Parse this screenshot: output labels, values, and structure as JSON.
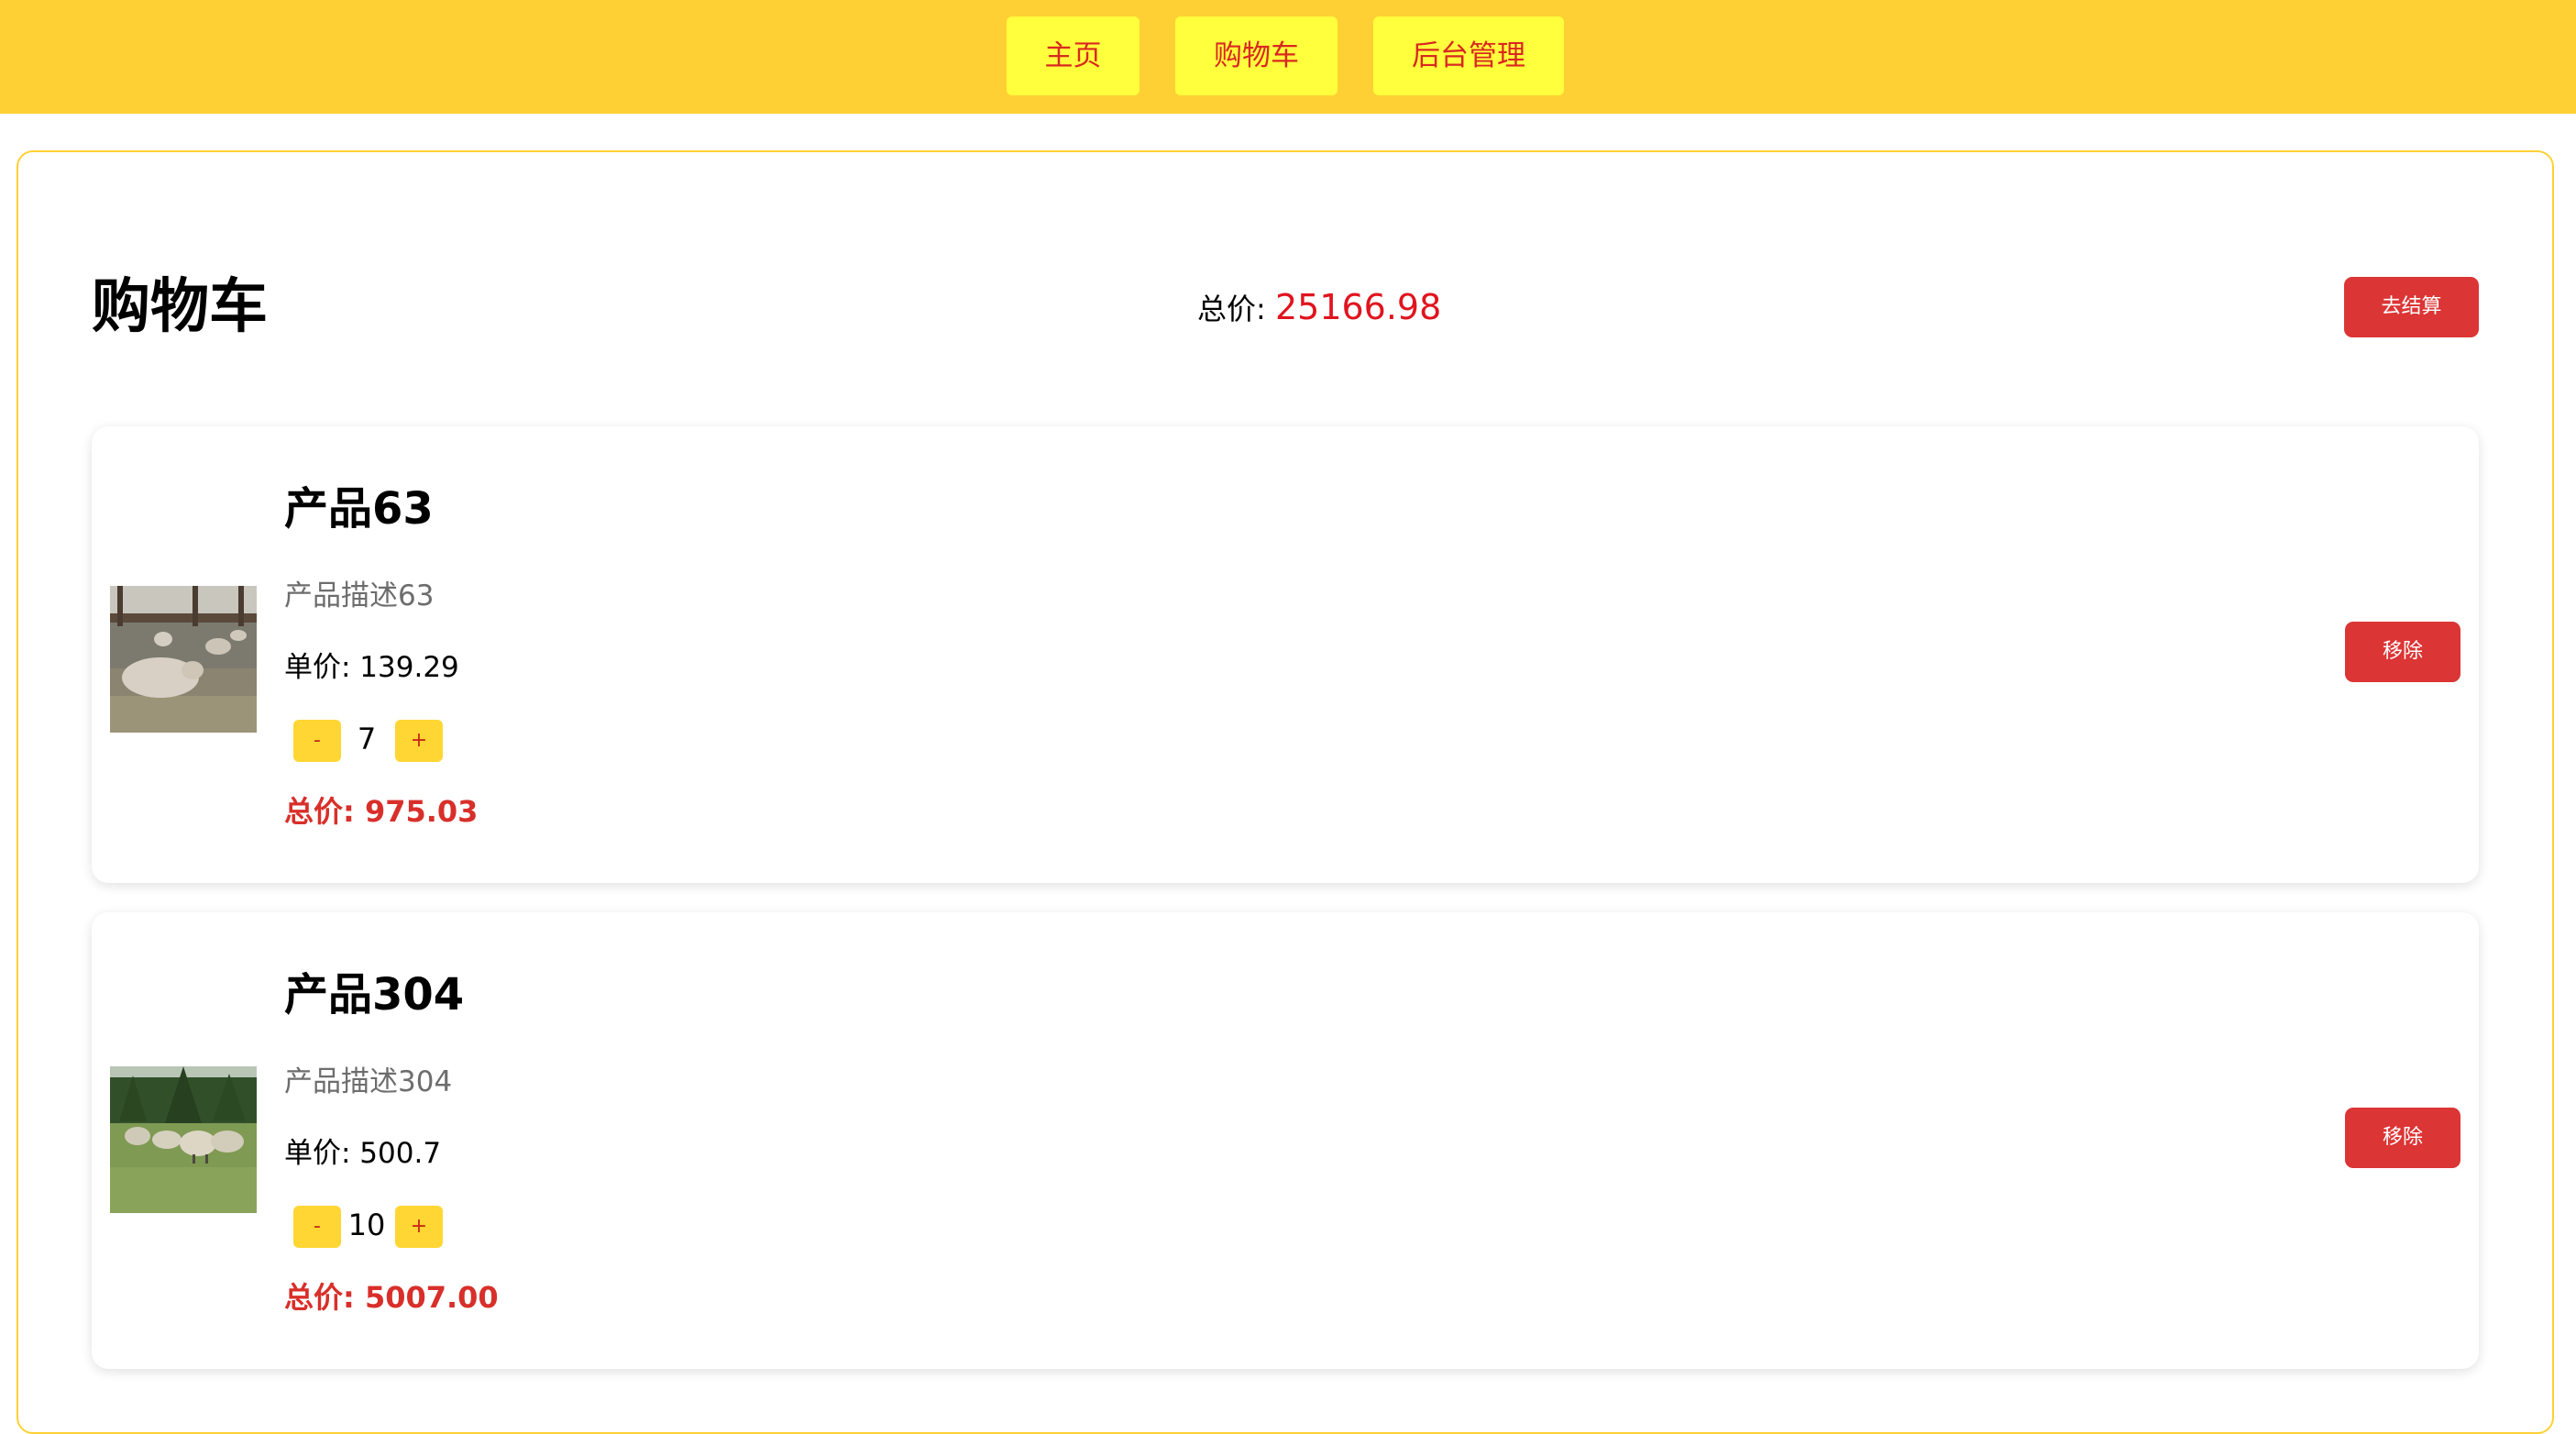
{
  "nav": {
    "items": [
      {
        "label": "主页"
      },
      {
        "label": "购物车"
      },
      {
        "label": "后台管理"
      }
    ]
  },
  "cart": {
    "title": "购物车",
    "total_label": "总价:",
    "total_value": "25166.98",
    "checkout_label": "去结算",
    "items": [
      {
        "name": "产品63",
        "description": "产品描述63",
        "unit_price": "单价: 139.29",
        "quantity": "7",
        "subtotal": "总价: 975.03",
        "image_icon": "sheep-in-barn-photo",
        "remove_label": "移除",
        "minus_label": "-",
        "plus_label": "+"
      },
      {
        "name": "产品304",
        "description": "产品描述304",
        "unit_price": "单价: 500.7",
        "quantity": "10",
        "subtotal": "总价: 5007.00",
        "image_icon": "sheep-in-field-photo",
        "remove_label": "移除",
        "minus_label": "-",
        "plus_label": "+"
      }
    ]
  },
  "colors": {
    "header_bg": "#ffd033",
    "nav_button_bg": "#ffff3d",
    "nav_text": "#d9281f",
    "danger_button": "#dc3535",
    "qty_button": "#ffd633",
    "total_red": "#e0141e",
    "subtotal_red": "#d82f2a"
  }
}
